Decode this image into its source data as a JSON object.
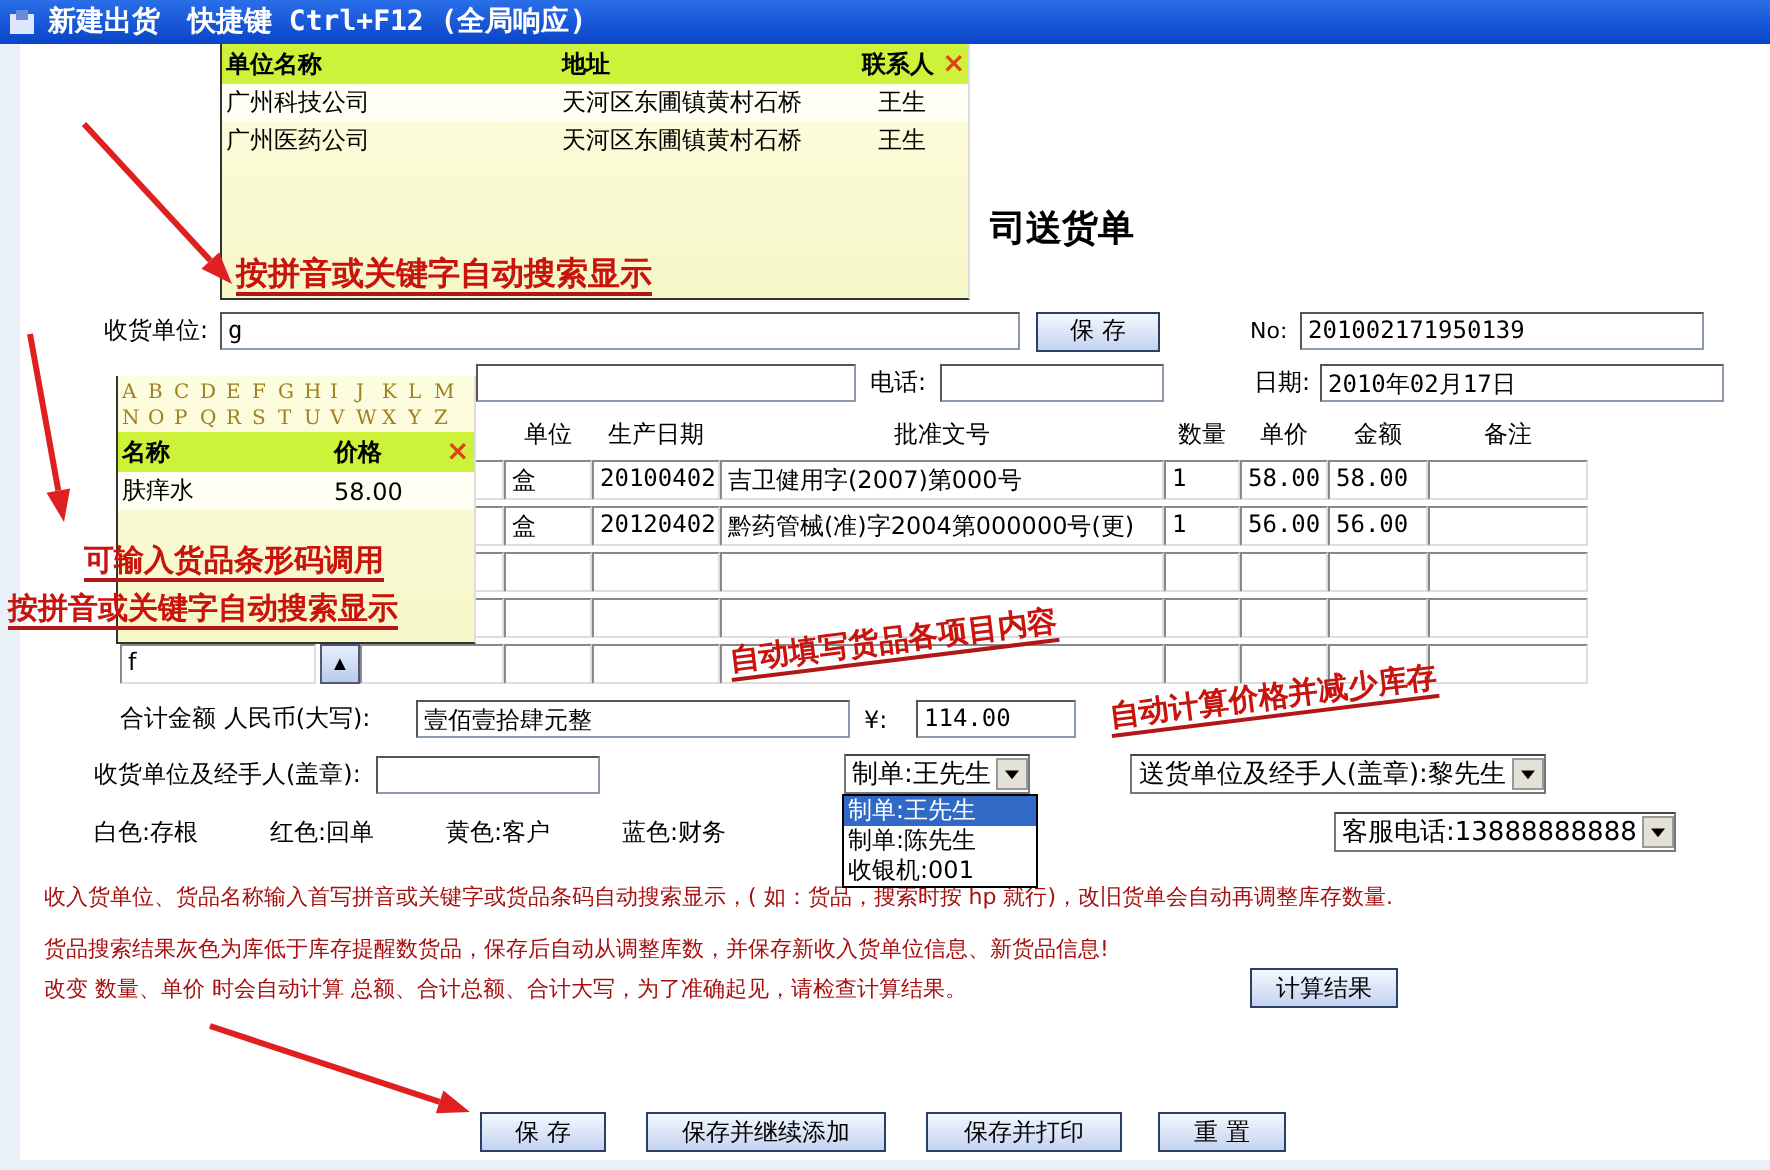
{
  "window": {
    "title": "新建出货　快捷键 Ctrl+F12 (全局响应)"
  },
  "form_title": "司送货单",
  "header": {
    "consignee": {
      "label": "收货单位:",
      "value": "g"
    },
    "save_button": "保 存",
    "number": {
      "label": "No:",
      "value": "201002171950139"
    },
    "phone": {
      "label": "电话:"
    },
    "date": {
      "label": "日期:",
      "value": "2010年02月17日"
    }
  },
  "table": {
    "columns": [
      "单位",
      "生产日期",
      "批准文号",
      "数量",
      "单价",
      "金额",
      "备注"
    ],
    "rows": [
      {
        "kind": "filled",
        "unit": "盒",
        "date": "20100402",
        "approval": "吉卫健用字(2007)第000号",
        "qty": "1",
        "price": "58.00",
        "amount": "58.00"
      },
      {
        "kind": "filled",
        "unit": "盒",
        "date": "20120402",
        "approval": "黔药管械(准)字2004第000000号(更)",
        "qty": "1",
        "price": "56.00",
        "amount": "56.00"
      },
      {
        "kind": "empty"
      },
      {
        "kind": "empty"
      },
      {
        "kind": "entry",
        "name": "f",
        "button": "▲"
      }
    ]
  },
  "totals": {
    "words_label": "合计金额 人民币(大写):",
    "words": "壹佰壹拾肆元整",
    "amount_label": "¥:",
    "amount": "114.00"
  },
  "signatures": {
    "receiver_label": "收货单位及经手人(盖章):",
    "maker": "制单:王先生",
    "sender": "送货单位及经手人(盖章):黎先生",
    "service_phone": "客服电话:13888888888"
  },
  "copies": [
    "白色:存根",
    "红色:回单",
    "黄色:客户",
    "蓝色:财务"
  ],
  "maker_options": [
    {
      "label": "制单:王先生",
      "selected": true
    },
    {
      "label": "制单:陈先生",
      "selected": false
    },
    {
      "label": "收银机:001",
      "selected": false
    }
  ],
  "notes": [
    "收入货单位、货品名称输入首写拼音或关键字或货品条码自动搜索显示，( 如：货品，搜索时按 hp 就行)，改旧货单会自动再调整库存数量.",
    "货品搜索结果灰色为库低于库存提醒数货品，保存后自动从调整库数，并保存新收入货单位信息、新货品信息!",
    "改变 数量、单价 时会自动计算 总额、合计总额、合计大写，为了准确起见，请检查计算结果。"
  ],
  "calc_button": "计算结果",
  "actions": [
    "保 存",
    "保存并继续添加",
    "保存并打印",
    "重 置"
  ],
  "customer_popup": {
    "columns": [
      "单位名称",
      "地址",
      "联系人"
    ],
    "close": "×",
    "rows": [
      {
        "name": "广州科技公司",
        "address": "天河区东圃镇黄村石桥",
        "contact": "王生",
        "selected": true
      },
      {
        "name": "广州医药公司",
        "address": "天河区东圃镇黄村石桥",
        "contact": "王生",
        "selected": false
      }
    ]
  },
  "product_popup": {
    "letters": [
      "A",
      "B",
      "C",
      "D",
      "E",
      "F",
      "G",
      "H",
      "I",
      "J",
      "K",
      "L",
      "M",
      "N",
      "O",
      "P",
      "Q",
      "R",
      "S",
      "T",
      "U",
      "V",
      "W",
      "X",
      "Y",
      "Z"
    ],
    "columns": [
      "名称",
      "价格"
    ],
    "close": "×",
    "rows": [
      {
        "name": "肤痒水",
        "price": "58.00"
      }
    ]
  },
  "annotations": [
    "按拼音或关键字自动搜索显示",
    "可输入货品条形码调用",
    "按拼音或关键字自动搜索显示",
    "自动填写货品各项目内容",
    "自动计算价格并减少库存"
  ]
}
